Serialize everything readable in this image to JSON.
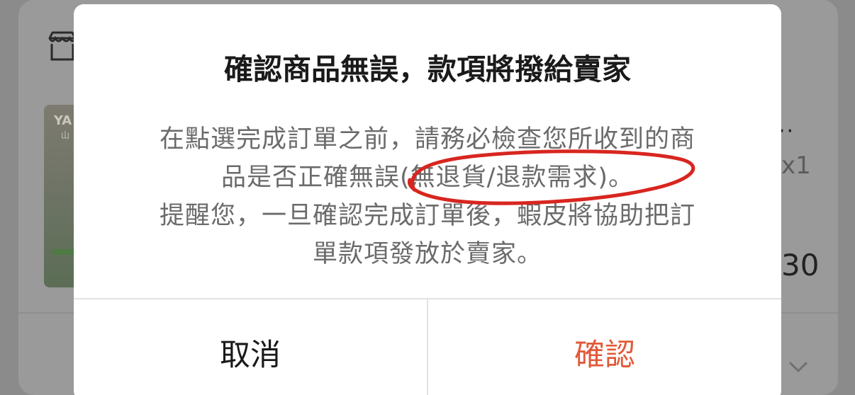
{
  "background": {
    "shop_icon": "shop-icon",
    "product_thumb_text_top": "YA",
    "product_thumb_text_sub": "山",
    "row_more": "··",
    "quantity": "x1",
    "price_fragment": "30",
    "chevron_icon": "chevron-down-icon"
  },
  "dialog": {
    "title": "確認商品無誤，款項將撥給賣家",
    "message_lines": [
      "在點選完成訂單之前，請務必檢查您所收到的商",
      "品是否正確無誤(無退貨/退款需求)。",
      "提醒您，一旦確認完成訂單後，蝦皮將協助把訂",
      "單款項發放於賣家。"
    ],
    "cancel_label": "取消",
    "confirm_label": "確認"
  },
  "colors": {
    "accent": "#e15a3a",
    "annotation": "#d8261f",
    "overlay": "#8b8b8b"
  }
}
